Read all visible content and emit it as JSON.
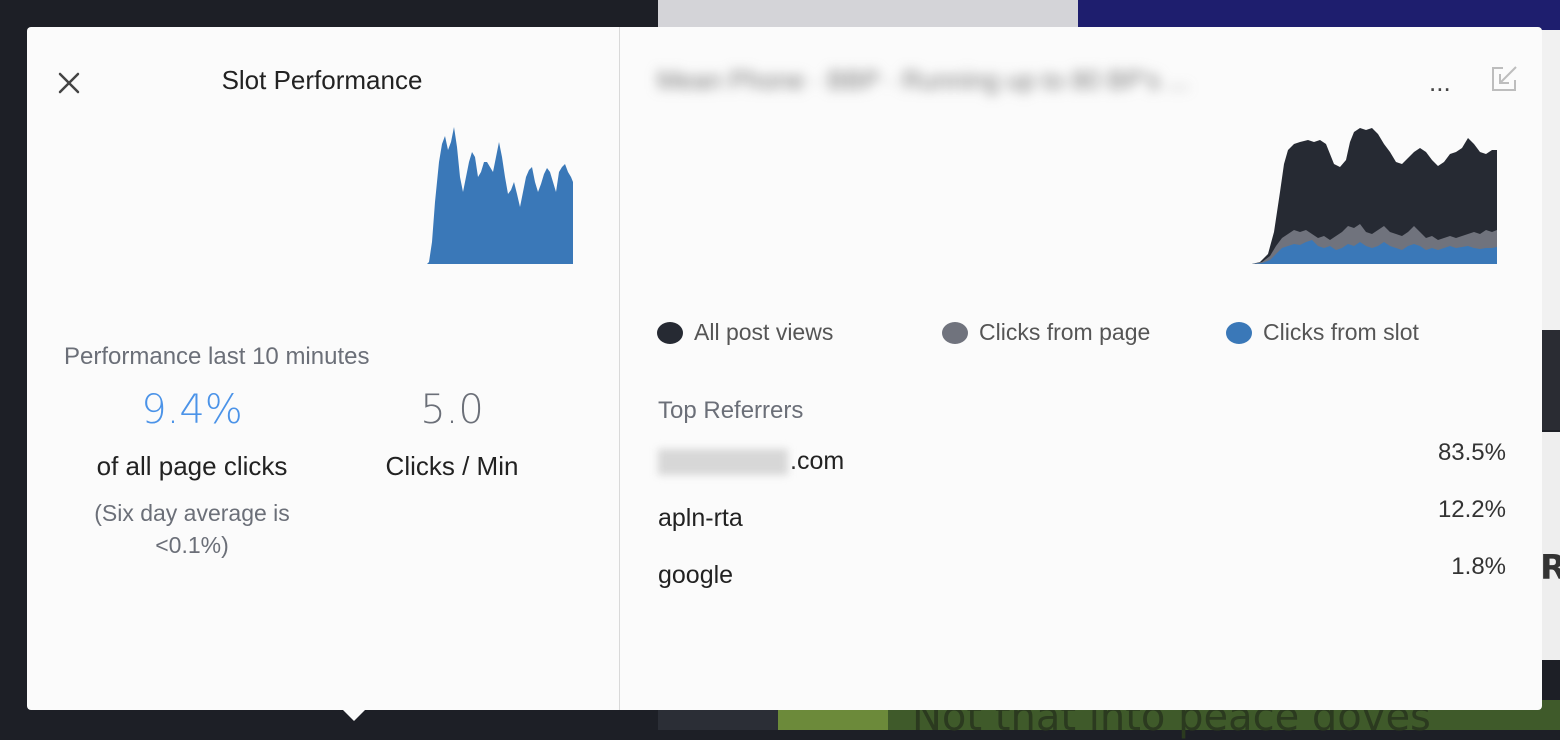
{
  "panel": {
    "title": "Slot Performance",
    "performance_label": "Performance last 10 minutes",
    "share_value": "9.4%",
    "share_caption": "of all page clicks",
    "average_note": "(Six day average is <0.1%)",
    "rate_value": "5.0",
    "rate_caption": "Clicks / Min"
  },
  "post": {
    "title_obscured": "Mean Phone · BBP · Running up to 80 BP's ...",
    "title_ellipsis": "..."
  },
  "legend": [
    {
      "label": "All post views",
      "color": "#262a33"
    },
    {
      "label": "Clicks from page",
      "color": "#70737d"
    },
    {
      "label": "Clicks from slot",
      "color": "#3a78b8"
    }
  ],
  "referrers": {
    "heading": "Top Referrers",
    "items": [
      {
        "name": ".com",
        "share": "83.5%",
        "obscured_prefix": true
      },
      {
        "name": "apln-rta",
        "share": "12.2%",
        "obscured_prefix": false
      },
      {
        "name": "google",
        "share": "1.8%",
        "obscured_prefix": false
      }
    ]
  },
  "background": {
    "partial_letter": "R",
    "bottom_text": "Not that into peace doves"
  },
  "colors": {
    "accent": "#4b93e8",
    "slot_blue": "#3a78b8",
    "dark_area": "#262a33",
    "gray_area": "#70737d"
  },
  "icons": {
    "close": "close-icon",
    "expand": "expand-icon"
  }
}
